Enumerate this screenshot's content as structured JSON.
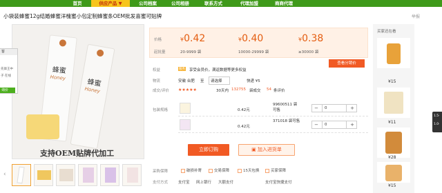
{
  "nav": {
    "items": [
      {
        "label": "首页",
        "active": false
      },
      {
        "label": "供应产品 ▼",
        "active": true
      },
      {
        "label": "公司档案",
        "active": false
      },
      {
        "label": "公司相册",
        "active": false
      },
      {
        "label": "联系方式",
        "active": false
      },
      {
        "label": "代理加盟",
        "active": false
      },
      {
        "label": "商商代理",
        "active": false
      }
    ]
  },
  "product": {
    "title": "小袋装蜂蜜12g结婚蜂蜜洋槐蜜小包定制蜂蜜条OEM批发喜蜜可贴牌",
    "report": "举报",
    "image_caption": "支持OEM贴牌代加工",
    "stick_label_1": "蜂蜜",
    "stick_label_2": "Honey",
    "stick_label_3": "蜂蜜",
    "stick_label_4": "Honey"
  },
  "leftpanel": {
    "header": "客",
    "text": "先锋王中",
    "text2": "子 在线",
    "button": "询价"
  },
  "price": {
    "label_price": "价格",
    "label_qty": "起批量",
    "tiers": [
      {
        "price": "0.42",
        "qty": "20-9999 袋"
      },
      {
        "price": "0.40",
        "qty": "10000-29999 袋"
      },
      {
        "price": "0.38",
        "qty": "≥30000 袋"
      }
    ],
    "currency": "¥",
    "wholesale_button": "查看分销价"
  },
  "details": {
    "rights_label": "权益",
    "rights_badge": "服务",
    "rights_text": "享受会员价，满返数据等更多权益",
    "shipping_label": "物流",
    "shipping_from": "安徽 合肥",
    "shipping_to_prefix": "至",
    "shipping_select": "请选择",
    "shipping_type": "快递 ¥5",
    "rating_label": "成交/评价",
    "stars": "★★★★★",
    "sales_prefix": "30天内",
    "sales_count": "132755",
    "sales_suffix": "袋成交",
    "reviews_count": "54",
    "reviews_suffix": "条评价"
  },
  "sku": {
    "label": "包装规格",
    "rows": [
      {
        "price": "0.42元",
        "stock": "99600511 袋可售",
        "quantity": "0"
      },
      {
        "price": "0.42元",
        "stock": "371018 袋可售",
        "quantity": "0"
      }
    ]
  },
  "actions": {
    "order_button": "立即订购",
    "cart_button": "加入进货单"
  },
  "promise": {
    "label_1": "采购保障",
    "label_2": "支付方式",
    "items_row1": [
      "破损补寄",
      "交易保障",
      "15天包换",
      "买家保障"
    ],
    "items_row2": [
      "支付宝",
      "网上银行",
      "大额支付",
      "支付宝快捷支付"
    ]
  },
  "recommend": {
    "title": "买家还在看",
    "items": [
      {
        "price": "¥15"
      },
      {
        "price": "¥11"
      },
      {
        "price": "¥28"
      },
      {
        "price": "¥15"
      }
    ]
  },
  "sidetab": {
    "line1": "1.5·",
    "line2": "1.0·"
  }
}
